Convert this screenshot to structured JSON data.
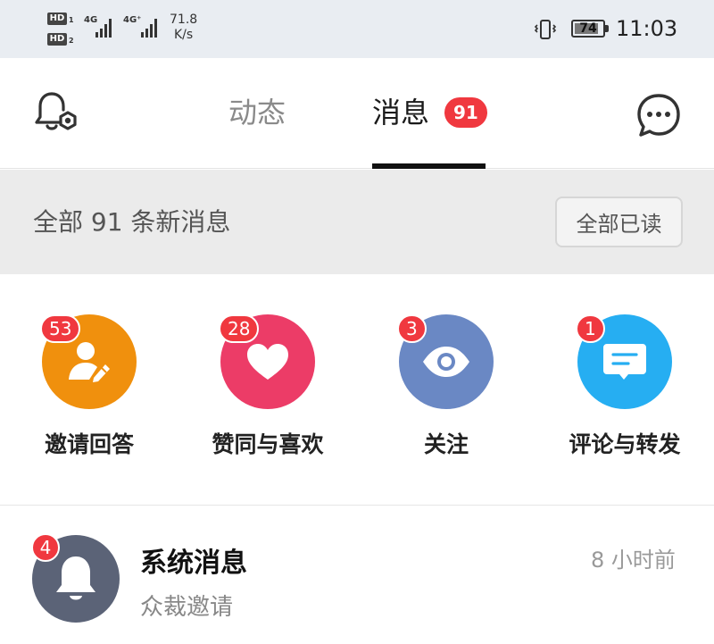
{
  "status_bar": {
    "sim1_label": "HD",
    "sim1_index": "1",
    "sim2_label": "HD",
    "sim2_index": "2",
    "network1": "4G",
    "network2": "4G⁺",
    "speed_value": "71.8",
    "speed_unit": "K/s",
    "battery": "74",
    "time": "11:03",
    "icons": [
      "vibrate-icon",
      "battery-icon"
    ]
  },
  "header": {
    "tabs": [
      {
        "label": "动态",
        "active": false
      },
      {
        "label": "消息",
        "active": true,
        "badge": "91"
      }
    ],
    "left_icon": "bell-settings-icon",
    "right_icon": "chat-bubble-icon"
  },
  "summary": {
    "text": "全部 91 条新消息",
    "read_all_label": "全部已读"
  },
  "categories": [
    {
      "label": "邀请回答",
      "badge": "53",
      "color": "#f0900d",
      "icon": "user-edit-icon"
    },
    {
      "label": "赞同与喜欢",
      "badge": "28",
      "color": "#ec3c67",
      "icon": "heart-icon"
    },
    {
      "label": "关注",
      "badge": "3",
      "color": "#6a88c4",
      "icon": "eye-icon"
    },
    {
      "label": "评论与转发",
      "badge": "1",
      "color": "#26aef2",
      "icon": "comment-icon"
    }
  ],
  "system_message": {
    "title": "系统消息",
    "subtitle": "众裁邀请",
    "time": "8 小时前",
    "badge": "4",
    "avatar_color": "#5b6377",
    "icon": "bell-icon"
  },
  "colors": {
    "badge_red": "#f0383f",
    "status_bar_bg": "#e9edf2",
    "summary_bg": "#ebebeb"
  }
}
